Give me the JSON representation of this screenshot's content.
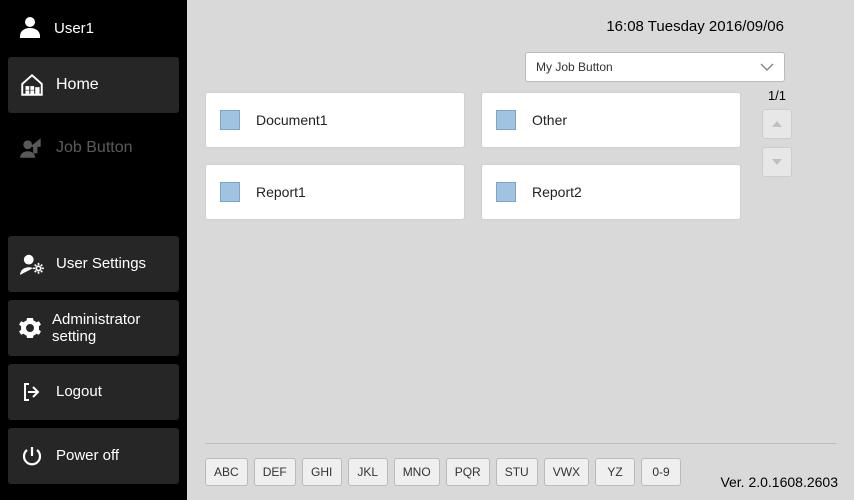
{
  "user": {
    "name": "User1"
  },
  "nav": {
    "home": "Home",
    "job_button": "Job Button",
    "user_settings": "User Settings",
    "admin_setting": "Administrator setting",
    "logout": "Logout",
    "power_off": "Power off"
  },
  "clock": "16:08 Tuesday 2016/09/06",
  "select": {
    "value": "My Job Button"
  },
  "cards": [
    {
      "label": "Document1"
    },
    {
      "label": "Other"
    },
    {
      "label": "Report1"
    },
    {
      "label": "Report2"
    }
  ],
  "pager": {
    "page": "1/1"
  },
  "filters": [
    "ABC",
    "DEF",
    "GHI",
    "JKL",
    "MNO",
    "PQR",
    "STU",
    "VWX",
    "YZ",
    "0-9"
  ],
  "version": "Ver. 2.0.1608.2603"
}
